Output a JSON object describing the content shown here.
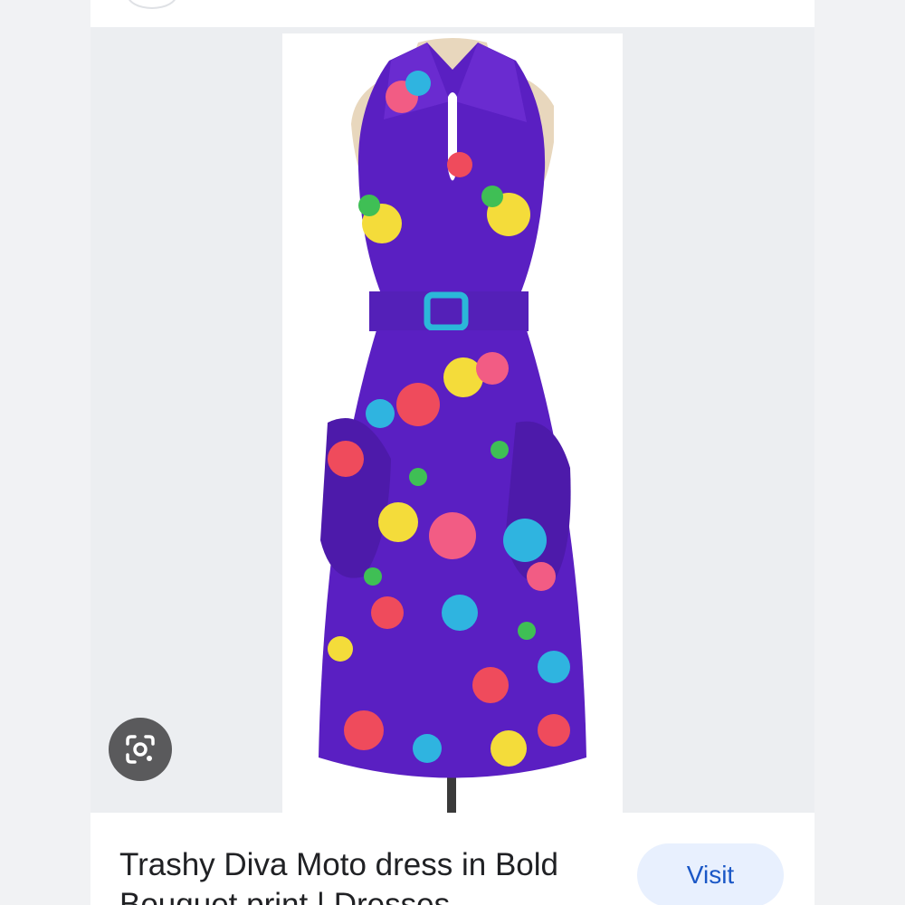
{
  "result": {
    "title": "Trashy Diva Moto dress in Bold Bouquet print | Dresses",
    "visit_label": "Visit"
  },
  "icons": {
    "lens": "google-lens-icon"
  },
  "colors": {
    "dress_purple": "#5a1fc2",
    "visit_bg": "#e8f0fe",
    "visit_text": "#1a57c6",
    "lens_bg": "#5a5a5c"
  }
}
